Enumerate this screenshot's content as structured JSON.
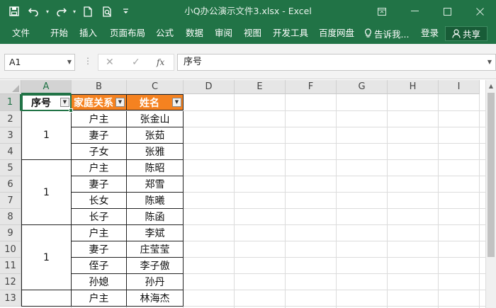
{
  "window": {
    "title": "小Q办公演示文件3.xlsx  -  Excel",
    "controls": [
      "ribbon-display-icon",
      "minimize-icon",
      "maximize-icon",
      "close-icon"
    ]
  },
  "quick_access": [
    "save-icon",
    "undo-icon",
    "redo-icon",
    "new-file-icon",
    "print-preview-icon",
    "customize-qat-icon"
  ],
  "ribbon": {
    "tabs": [
      "文件",
      "开始",
      "插入",
      "页面布局",
      "公式",
      "数据",
      "审阅",
      "视图",
      "开发工具",
      "百度网盘"
    ],
    "tell_me": "告诉我...",
    "login": "登录",
    "share": "共享"
  },
  "formula_bar": {
    "name_box": "A1",
    "cancel": "✕",
    "enter": "✓",
    "fx": "fx",
    "content": "序号"
  },
  "grid": {
    "columns": [
      "A",
      "B",
      "C",
      "D",
      "E",
      "F",
      "G",
      "H",
      "I"
    ],
    "rows": [
      "1",
      "2",
      "3",
      "4",
      "5",
      "6",
      "7",
      "8",
      "9",
      "10",
      "11",
      "12",
      "13"
    ],
    "selected_cell": "A1"
  },
  "table": {
    "headers": [
      "序号",
      "家庭关系",
      "姓名"
    ],
    "header_colors": {
      "plain": "#ffffff",
      "accent": "#f58220"
    },
    "groups": [
      {
        "seq": "1",
        "rows": [
          [
            "户主",
            "张金山"
          ],
          [
            "妻子",
            "张茹"
          ],
          [
            "子女",
            "张雅"
          ]
        ]
      },
      {
        "seq": "1",
        "rows": [
          [
            "户主",
            "陈昭"
          ],
          [
            "妻子",
            "郑雪"
          ],
          [
            "长女",
            "陈曦"
          ],
          [
            "长子",
            "陈函"
          ]
        ]
      },
      {
        "seq": "1",
        "rows": [
          [
            "户主",
            "李斌"
          ],
          [
            "妻子",
            "庄莹莹"
          ],
          [
            "侄子",
            "李子傲"
          ],
          [
            "孙媳",
            "孙丹"
          ]
        ]
      },
      {
        "seq": "",
        "rows": [
          [
            "户主",
            "林海杰"
          ]
        ]
      }
    ]
  }
}
